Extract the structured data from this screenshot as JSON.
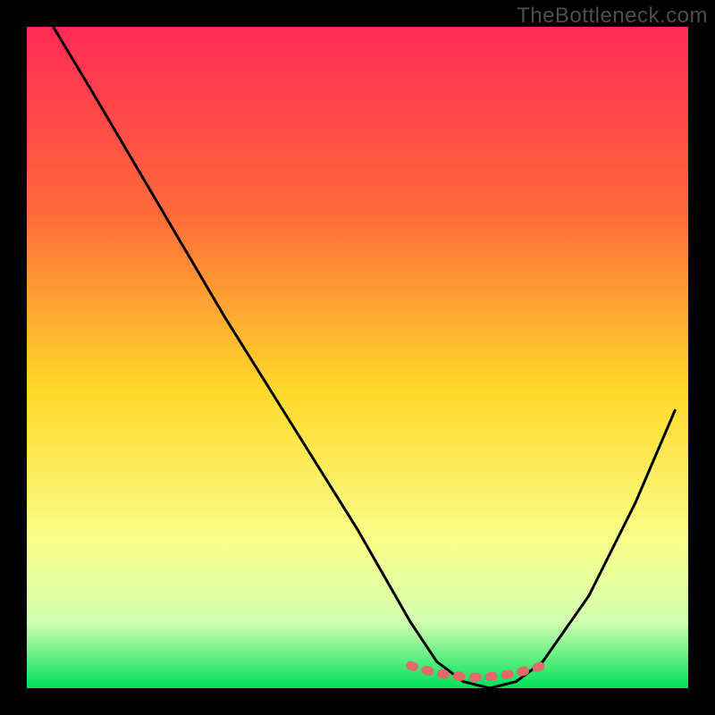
{
  "watermark": "TheBottleneck.com",
  "chart_data": {
    "type": "line",
    "title": "",
    "xlabel": "",
    "ylabel": "",
    "xlim": [
      0,
      100
    ],
    "ylim": [
      0,
      100
    ],
    "grid": false,
    "background_gradient": {
      "top": "#ff2a55",
      "upper_mid": "#ff8a2a",
      "mid": "#ffd92a",
      "lower_mid": "#f9ff8a",
      "near_bottom": "#d2ffb0",
      "bottom": "#00e05a"
    },
    "series": [
      {
        "name": "bottleneck-curve",
        "color": "#000000",
        "x": [
          4,
          10,
          20,
          30,
          40,
          50,
          58,
          62,
          66,
          70,
          74,
          78,
          85,
          92,
          98
        ],
        "values": [
          100,
          90,
          73,
          56,
          40,
          24,
          10,
          4,
          1,
          0,
          1,
          4,
          14,
          28,
          42
        ]
      }
    ],
    "optimal_band": {
      "name": "optimal-zone-marker",
      "color": "#e26a6a",
      "x_start": 58,
      "x_end": 78,
      "y": 1
    }
  }
}
